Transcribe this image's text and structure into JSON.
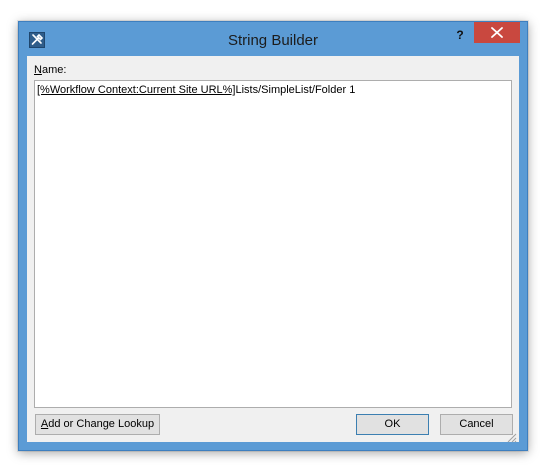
{
  "window": {
    "title": "String Builder",
    "help_label": "?",
    "accent_color": "#5b9bd5",
    "close_color": "#c9483f"
  },
  "icons": {
    "app": "tools-icon",
    "close": "close-icon",
    "grip": "resize-grip-icon"
  },
  "form": {
    "name_label_accel": "N",
    "name_label_rest": "ame:",
    "value_lookup": "[%Workflow Context:Current Site URL%]",
    "value_text": "Lists/SimpleList/Folder 1"
  },
  "buttons": {
    "lookup_accel": "A",
    "lookup_rest": "dd or Change Lookup",
    "ok": "OK",
    "cancel": "Cancel"
  }
}
